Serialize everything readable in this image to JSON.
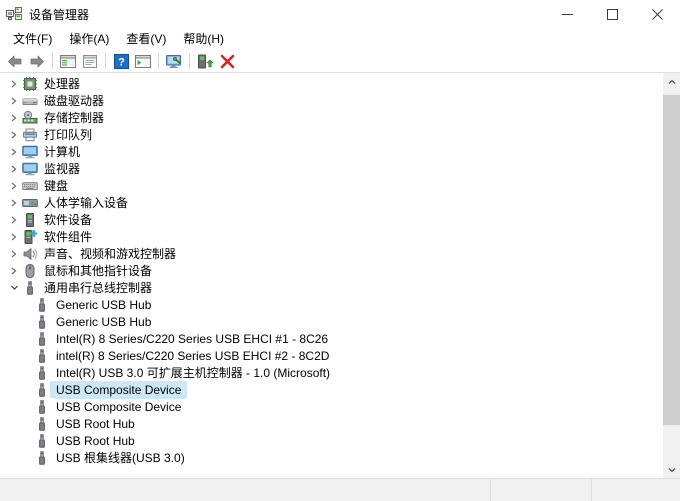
{
  "window": {
    "title": "设备管理器",
    "icon": "device-manager-icon",
    "controls": {
      "minimize": "minimize-icon",
      "maximize": "maximize-icon",
      "close": "close-icon"
    }
  },
  "menubar": {
    "items": [
      {
        "label": "文件(F)",
        "name": "menu-file"
      },
      {
        "label": "操作(A)",
        "name": "menu-action"
      },
      {
        "label": "查看(V)",
        "name": "menu-view"
      },
      {
        "label": "帮助(H)",
        "name": "menu-help"
      }
    ]
  },
  "toolbar": {
    "buttons": [
      {
        "name": "back-arrow-icon",
        "type": "arrow-left",
        "title": "后退"
      },
      {
        "name": "forward-arrow-icon",
        "type": "arrow-right",
        "title": "前进"
      },
      {
        "name": "separator-1",
        "type": "separator"
      },
      {
        "name": "show-hide-console-tree-icon",
        "type": "window-green",
        "title": "显示/隐藏控制台树"
      },
      {
        "name": "properties-icon",
        "type": "window-props",
        "title": "属性"
      },
      {
        "name": "separator-2",
        "type": "separator"
      },
      {
        "name": "help-icon",
        "type": "help-blue",
        "title": "帮助"
      },
      {
        "name": "update-driver-icon",
        "type": "window-green2",
        "title": "更新驱动程序"
      },
      {
        "name": "separator-3",
        "type": "separator"
      },
      {
        "name": "scan-hardware-changes-icon",
        "type": "monitor-scan",
        "title": "扫描检测硬件改动"
      },
      {
        "name": "separator-4",
        "type": "separator"
      },
      {
        "name": "enable-device-icon",
        "type": "device-enable",
        "title": "启用设备"
      },
      {
        "name": "uninstall-device-icon",
        "type": "red-x",
        "title": "卸载设备"
      }
    ]
  },
  "tree": {
    "categories": [
      {
        "label": "处理器",
        "icon": "processor-icon",
        "expanded": false
      },
      {
        "label": "磁盘驱动器",
        "icon": "disk-drive-icon",
        "expanded": false
      },
      {
        "label": "存储控制器",
        "icon": "storage-controller-icon",
        "expanded": false
      },
      {
        "label": "打印队列",
        "icon": "print-queue-icon",
        "expanded": false
      },
      {
        "label": "计算机",
        "icon": "computer-icon",
        "expanded": false
      },
      {
        "label": "监视器",
        "icon": "monitor-icon",
        "expanded": false
      },
      {
        "label": "键盘",
        "icon": "keyboard-icon",
        "expanded": false
      },
      {
        "label": "人体学输入设备",
        "icon": "hid-icon",
        "expanded": false
      },
      {
        "label": "软件设备",
        "icon": "software-device-icon",
        "expanded": false
      },
      {
        "label": "软件组件",
        "icon": "software-component-icon",
        "expanded": false
      },
      {
        "label": "声音、视频和游戏控制器",
        "icon": "sound-video-game-icon",
        "expanded": false
      },
      {
        "label": "鼠标和其他指针设备",
        "icon": "mouse-icon",
        "expanded": false
      },
      {
        "label": "通用串行总线控制器",
        "icon": "usb-controller-icon",
        "expanded": true
      }
    ],
    "usb_devices": [
      {
        "label": "Generic USB Hub",
        "icon": "usb-device-icon",
        "selected": false
      },
      {
        "label": "Generic USB Hub",
        "icon": "usb-device-icon",
        "selected": false
      },
      {
        "label": "Intel(R) 8 Series/C220 Series USB EHCI #1 - 8C26",
        "icon": "usb-device-icon",
        "selected": false
      },
      {
        "label": "intel(R) 8 Series/C220 Series USB EHCI #2 - 8C2D",
        "icon": "usb-device-icon",
        "selected": false
      },
      {
        "label": "Intel(R) USB 3.0 可扩展主机控制器 - 1.0 (Microsoft)",
        "icon": "usb-device-icon",
        "selected": false
      },
      {
        "label": "USB Composite Device",
        "icon": "usb-device-icon",
        "selected": true
      },
      {
        "label": "USB Composite Device",
        "icon": "usb-device-icon",
        "selected": false
      },
      {
        "label": "USB Root Hub",
        "icon": "usb-device-icon",
        "selected": false
      },
      {
        "label": "USB Root Hub",
        "icon": "usb-device-icon",
        "selected": false
      },
      {
        "label": "USB 根集线器(USB 3.0)",
        "icon": "usb-device-icon",
        "selected": false
      }
    ]
  },
  "scrollbar": {
    "up_arrow": "scroll-up-icon",
    "down_arrow": "scroll-down-icon",
    "thumb_top_pct": 6,
    "thumb_height_pct": 81
  },
  "statusbar": {
    "panes": [
      "",
      "",
      ""
    ]
  },
  "colors": {
    "selection": "#cce8f7",
    "accent_red": "#e81123",
    "accent_blue": "#2a7fd4",
    "accent_green": "#4ca64c",
    "chrome": "#f0f0f0"
  }
}
